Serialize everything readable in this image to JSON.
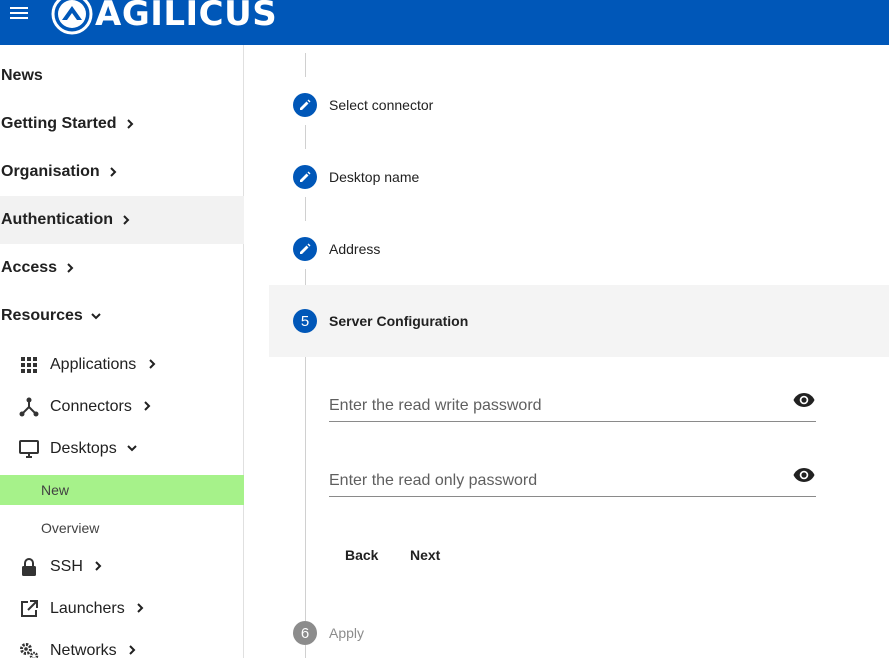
{
  "header": {
    "brand": "AGILICUS",
    "menu_icon": "menu-icon",
    "background": "#0057b8"
  },
  "sidebar": {
    "top_items": [
      {
        "label": "News",
        "expand": "none"
      },
      {
        "label": "Getting Started",
        "expand": "collapsed"
      },
      {
        "label": "Organisation",
        "expand": "collapsed"
      },
      {
        "label": "Authentication",
        "expand": "collapsed",
        "highlighted": true
      },
      {
        "label": "Access",
        "expand": "collapsed"
      },
      {
        "label": "Resources",
        "expand": "expanded"
      }
    ],
    "resources": [
      {
        "label": "Applications",
        "icon": "apps-grid-icon",
        "expand": "collapsed"
      },
      {
        "label": "Connectors",
        "icon": "connectors-icon",
        "expand": "collapsed"
      },
      {
        "label": "Desktops",
        "icon": "desktop-icon",
        "expand": "expanded"
      },
      {
        "label": "SSH",
        "icon": "lock-icon",
        "expand": "collapsed"
      },
      {
        "label": "Launchers",
        "icon": "open-in-new-icon",
        "expand": "collapsed"
      },
      {
        "label": "Networks",
        "icon": "settings-gears-icon",
        "expand": "collapsed"
      }
    ],
    "desktop_children": [
      {
        "label": "New",
        "selected": true
      },
      {
        "label": "Overview",
        "selected": false
      }
    ],
    "selected_color": "#a6f28a"
  },
  "stepper": {
    "steps": [
      {
        "label": "Select connector",
        "state": "done",
        "icon": "edit-pencil-icon"
      },
      {
        "label": "Desktop name",
        "state": "done",
        "icon": "edit-pencil-icon"
      },
      {
        "label": "Address",
        "state": "done",
        "icon": "edit-pencil-icon"
      },
      {
        "label": "Server Configuration",
        "state": "current",
        "number": "5"
      },
      {
        "label": "Apply",
        "state": "pending",
        "number": "6"
      }
    ],
    "fields": {
      "rw_password": {
        "placeholder": "Enter the read write password",
        "value": ""
      },
      "ro_password": {
        "placeholder": "Enter the read only password",
        "value": ""
      }
    },
    "buttons": {
      "back": "Back",
      "next": "Next"
    },
    "accent": "#0057b8"
  }
}
